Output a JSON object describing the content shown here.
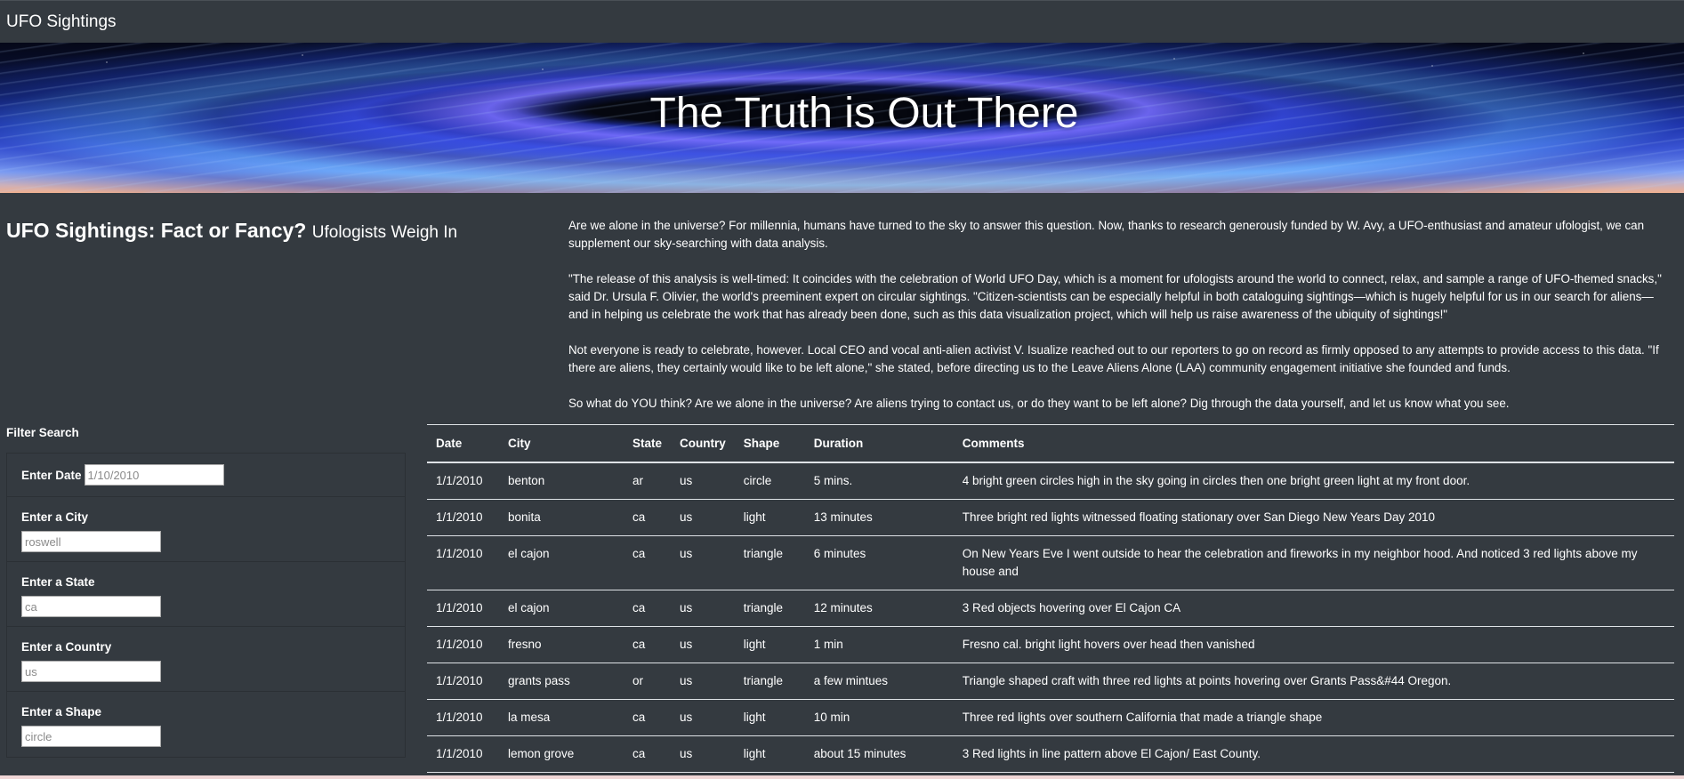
{
  "navbar": {
    "brand": "UFO Sightings"
  },
  "hero": {
    "title": "The Truth is Out There"
  },
  "headline": {
    "title": "UFO Sightings: Fact or Fancy?",
    "subtitle": "Ufologists Weigh In"
  },
  "article": {
    "paragraphs": [
      "Are we alone in the universe? For millennia, humans have turned to the sky to answer this question. Now, thanks to research generously funded by W. Avy, a UFO-enthusiast and amateur ufologist, we can supplement our sky-searching with data analysis.",
      "\"The release of this analysis is well-timed: It coincides with the celebration of World UFO Day, which is a moment for ufologists around the world to connect, relax, and sample a range of UFO-themed snacks,\" said Dr. Ursula F. Olivier, the world's preeminent expert on circular sightings. \"Citizen-scientists can be especially helpful in both cataloguing sightings—which is hugely helpful for us in our search for aliens—and in helping us celebrate the work that has already been done, such as this data visualization project, which will help us raise awareness of the ubiquity of sightings!\"",
      "Not everyone is ready to celebrate, however. Local CEO and vocal anti-alien activist V. Isualize reached out to our reporters to go on record as firmly opposed to any attempts to provide access to this data. \"If there are aliens, they certainly would like to be left alone,\" she stated, before directing us to the Leave Aliens Alone (LAA) community engagement initiative she founded and funds.",
      "So what do YOU think? Are we alone in the universe? Are aliens trying to contact us, or do they want to be left alone? Dig through the data yourself, and let us know what you see."
    ]
  },
  "filters": {
    "title": "Filter Search",
    "date": {
      "label": "Enter Date",
      "placeholder": "1/10/2010"
    },
    "city": {
      "label": "Enter a City",
      "placeholder": "roswell"
    },
    "state": {
      "label": "Enter a State",
      "placeholder": "ca"
    },
    "country": {
      "label": "Enter a Country",
      "placeholder": "us"
    },
    "shape": {
      "label": "Enter a Shape",
      "placeholder": "circle"
    }
  },
  "table": {
    "headers": [
      "Date",
      "City",
      "State",
      "Country",
      "Shape",
      "Duration",
      "Comments"
    ],
    "rows": [
      [
        "1/1/2010",
        "benton",
        "ar",
        "us",
        "circle",
        "5 mins.",
        "4 bright green circles high in the sky going in circles then one bright green light at my front door."
      ],
      [
        "1/1/2010",
        "bonita",
        "ca",
        "us",
        "light",
        "13 minutes",
        "Three bright red lights witnessed floating stationary over San Diego New Years Day 2010"
      ],
      [
        "1/1/2010",
        "el cajon",
        "ca",
        "us",
        "triangle",
        "6 minutes",
        "On New Years Eve I went outside to hear the celebration and fireworks in my neighbor hood. And noticed 3 red lights above my house and"
      ],
      [
        "1/1/2010",
        "el cajon",
        "ca",
        "us",
        "triangle",
        "12 minutes",
        "3 Red objects hovering over El Cajon CA"
      ],
      [
        "1/1/2010",
        "fresno",
        "ca",
        "us",
        "light",
        "1 min",
        "Fresno cal. bright light hovers over head then vanished"
      ],
      [
        "1/1/2010",
        "grants pass",
        "or",
        "us",
        "triangle",
        "a few mintues",
        "Triangle shaped craft with three red lights at points hovering over Grants Pass&#44 Oregon."
      ],
      [
        "1/1/2010",
        "la mesa",
        "ca",
        "us",
        "light",
        "10 min",
        "Three red lights over southern California that made a triangle shape"
      ],
      [
        "1/1/2010",
        "lemon grove",
        "ca",
        "us",
        "light",
        "about 15 minutes",
        "3 Red lights in line pattern above El Cajon/ East County."
      ]
    ]
  },
  "colors": {
    "background": "#343a40",
    "text": "#ffffff",
    "table_border": "#dee2e6"
  }
}
